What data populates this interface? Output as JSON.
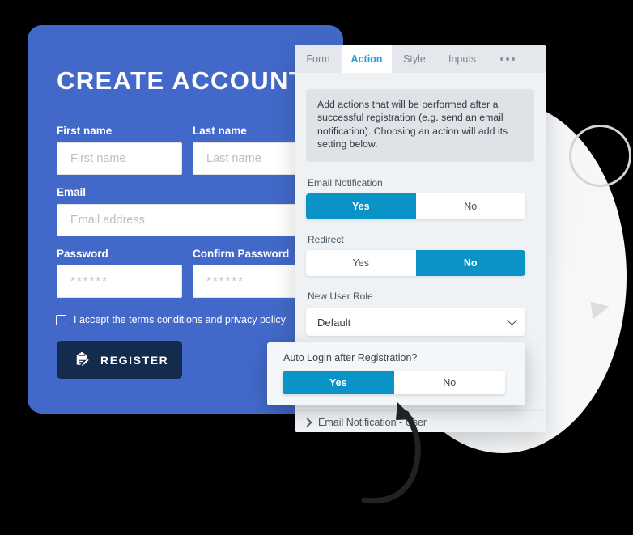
{
  "registration_card": {
    "title": "CREATE ACCOUNT",
    "brand_color": "#4269c9",
    "fields": [
      {
        "label": "First name",
        "placeholder": "First name"
      },
      {
        "label": "Last name",
        "placeholder": "Last name"
      },
      {
        "label": "Email",
        "placeholder": "Email address"
      },
      {
        "label": "Password",
        "placeholder": "******"
      },
      {
        "label": "Confirm Password",
        "placeholder": "******"
      }
    ],
    "terms": {
      "checkbox_icon": "checkbox-unchecked-icon",
      "label": "I accept the terms conditions and privacy policy",
      "checked": false
    },
    "submit": {
      "label": "REGISTER",
      "icon": "clipboard-pencil-icon",
      "background": "#132b4d"
    }
  },
  "settings_panel": {
    "accent_color": "#0a93c6",
    "tabs": [
      {
        "label": "Form",
        "active": false
      },
      {
        "label": "Action",
        "active": true
      },
      {
        "label": "Style",
        "active": false
      },
      {
        "label": "Inputs",
        "active": false
      }
    ],
    "overflow_icon": "ellipsis-icon",
    "help_text": "Add actions that will be performed after a successful registration (e.g. send an email notification). Choosing an action will add its setting below.",
    "settings": [
      {
        "label": "Email Notification",
        "options": [
          "Yes",
          "No"
        ],
        "selected": "Yes"
      },
      {
        "label": "Redirect",
        "options": [
          "Yes",
          "No"
        ],
        "selected": "No"
      }
    ],
    "select": {
      "label": "New User Role",
      "value": "Default",
      "chevron_icon": "chevron-down-icon"
    },
    "accordion": {
      "chevron_icon": "chevron-right-icon",
      "label": "Email Notification - User"
    }
  },
  "popup": {
    "title": "Auto Login after Registration?",
    "options": [
      "Yes",
      "No"
    ],
    "selected": "Yes"
  },
  "decorations": {
    "blob": "background-blob-shape",
    "ring": "outline-circle-shape",
    "triangle": "triangle-marker-shape",
    "arrow": "curved-pointer-arrow"
  }
}
